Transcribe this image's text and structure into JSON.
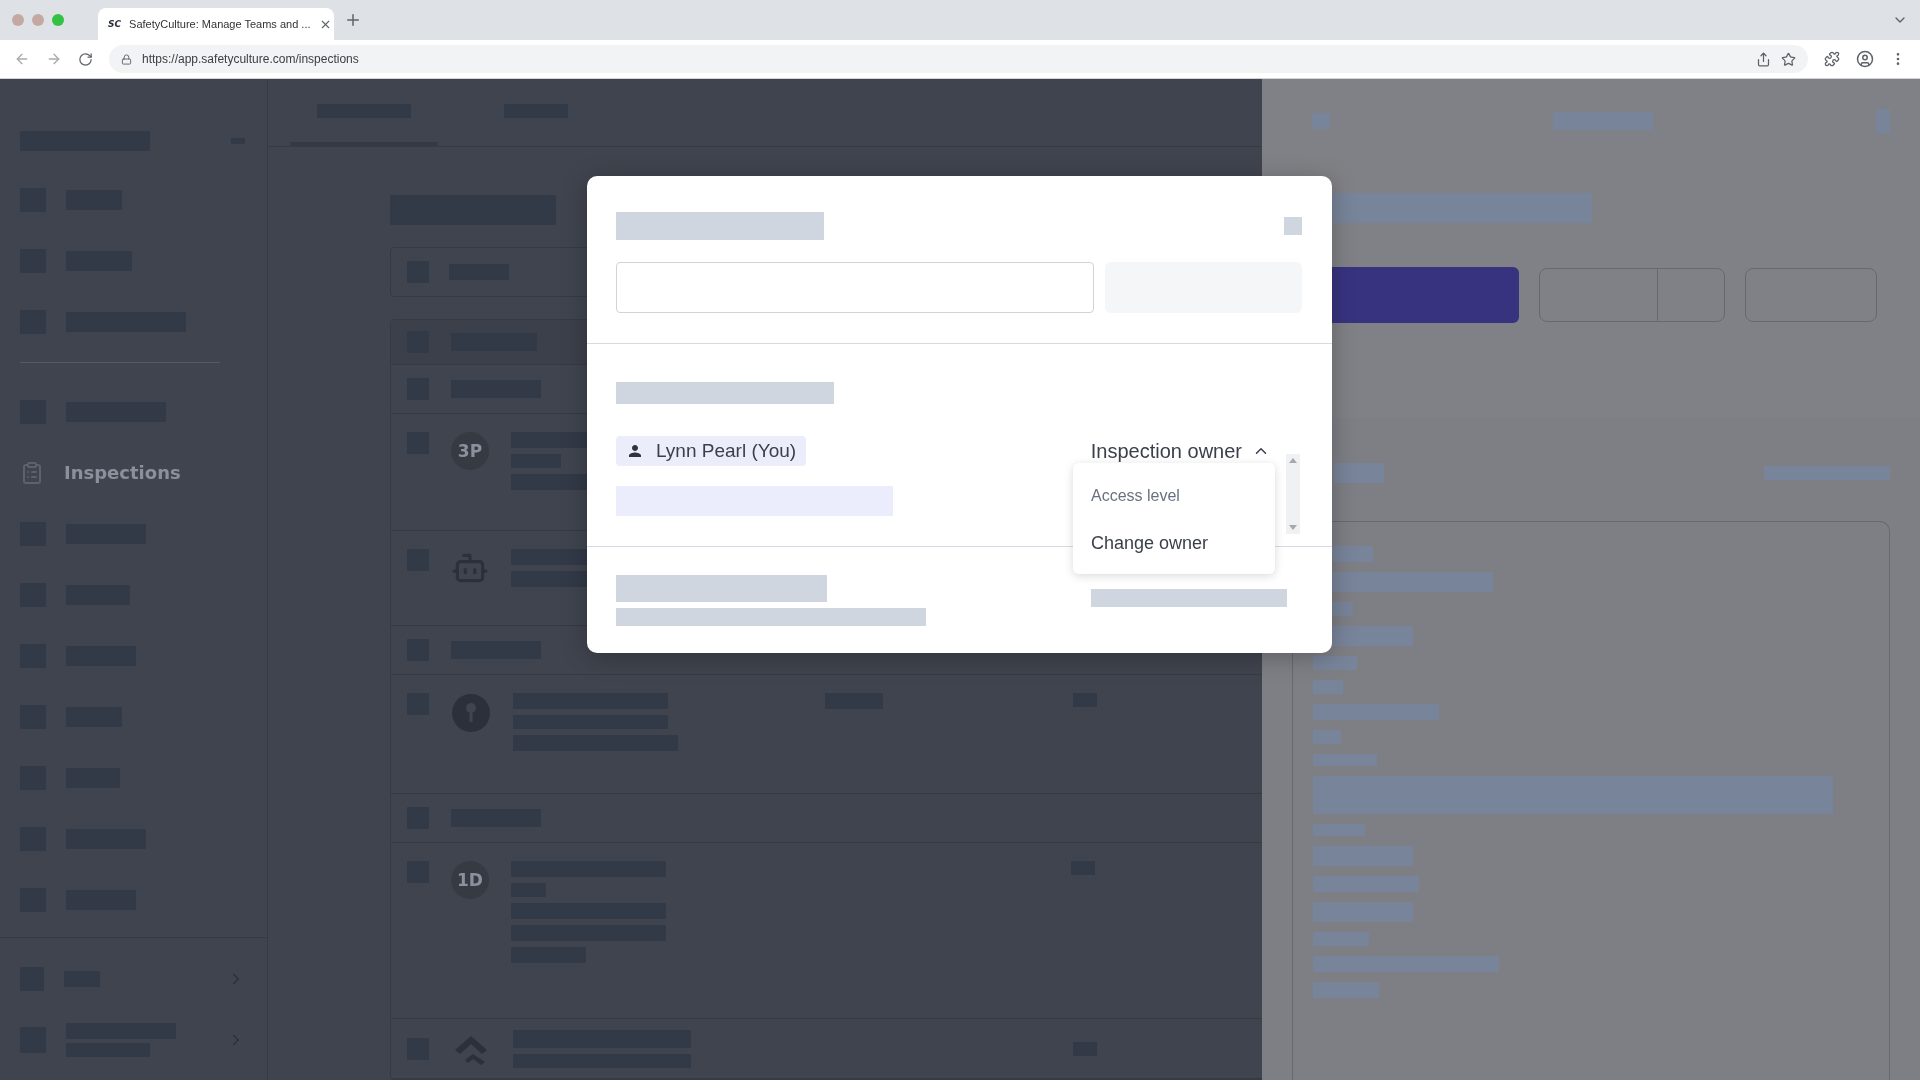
{
  "browser": {
    "favicon": "SC",
    "tab_title": "SafetyCulture: Manage Teams and ...",
    "url": "https://app.safetyculture.com/inspections"
  },
  "sidebar": {
    "active_item": {
      "label": "Inspections"
    }
  },
  "list": {
    "rows": [
      {
        "kind": "header"
      },
      {
        "kind": "group"
      },
      {
        "kind": "initials",
        "initials": "3P"
      },
      {
        "kind": "robot"
      },
      {
        "kind": "group"
      },
      {
        "kind": "pin"
      },
      {
        "kind": "group"
      },
      {
        "kind": "initials",
        "initials": "1D"
      },
      {
        "kind": "logo"
      }
    ]
  },
  "dialog": {
    "owner_chip": "Lynn Pearl (You)",
    "role": {
      "label": "Inspection owner",
      "expanded": true
    },
    "menu": [
      {
        "kind": "heading",
        "label": "Access level"
      },
      {
        "kind": "option",
        "label": "Change owner"
      }
    ]
  }
}
